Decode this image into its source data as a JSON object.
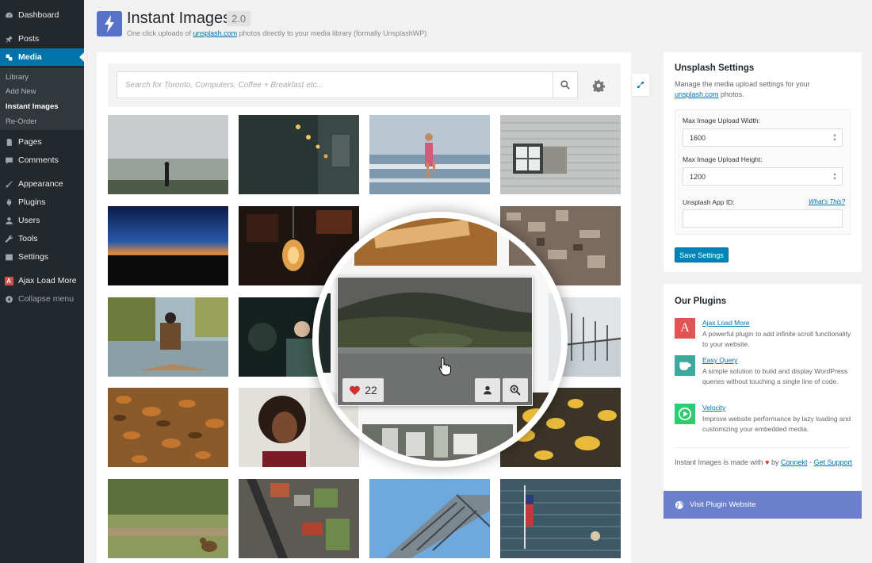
{
  "sidebar": {
    "items": [
      {
        "label": "Dashboard",
        "icon": "dashboard-icon"
      },
      {
        "label": "Posts",
        "icon": "pin-icon"
      },
      {
        "label": "Media",
        "icon": "media-icon"
      },
      {
        "label": "Pages",
        "icon": "pages-icon"
      },
      {
        "label": "Comments",
        "icon": "comments-icon"
      },
      {
        "label": "Appearance",
        "icon": "brush-icon"
      },
      {
        "label": "Plugins",
        "icon": "plug-icon"
      },
      {
        "label": "Users",
        "icon": "user-icon"
      },
      {
        "label": "Tools",
        "icon": "wrench-icon"
      },
      {
        "label": "Settings",
        "icon": "settings-icon"
      },
      {
        "label": "Ajax Load More",
        "icon": "ajax-load-more-icon"
      },
      {
        "label": "Collapse menu",
        "icon": "collapse-icon"
      }
    ],
    "submenu": [
      "Library",
      "Add New",
      "Instant Images",
      "Re-Order"
    ],
    "alm_icon_letter": "A"
  },
  "header": {
    "title": "Instant Images",
    "version": "2.0",
    "desc_before": "One click uploads of",
    "desc_link": "unsplash.com",
    "desc_after": "photos directly to your media library (formally UnsplashWP)"
  },
  "search": {
    "placeholder": "Search for Toronto, Computers, Coffee + Breakfast etc..."
  },
  "magnifier": {
    "likes": "22"
  },
  "settings_box": {
    "title": "Unsplash Settings",
    "desc_before": "Manage the media upload settings for your",
    "desc_link": "unsplash.com",
    "desc_after": "photos.",
    "width_label": "Max Image Upload Width:",
    "width_value": "1600",
    "height_label": "Max Image Upload Height:",
    "height_value": "1200",
    "appid_label": "Unsplash App ID:",
    "appid_value": "",
    "whats_this": "What's This?",
    "save_label": "Save Settings"
  },
  "plugins_box": {
    "title": "Our Plugins",
    "plugins": [
      {
        "name": "Ajax Load More",
        "desc": "A powerful plugin to add infinite scroll functionality to your website.",
        "color": "#e35353",
        "icon": "A"
      },
      {
        "name": "Easy Query",
        "desc": "A simple solution to build and display WordPress queries without touching a single line of code.",
        "color": "#3ba99c",
        "icon": "cup"
      },
      {
        "name": "Velocity",
        "desc": "Improve website performance by lazy loading and customizing your embedded media.",
        "color": "#2ecc71",
        "icon": "play"
      }
    ],
    "footer_before": "Instant Images is made with",
    "footer_by": "by",
    "footer_link1": "Connekt",
    "footer_sep": "-",
    "footer_link2": "Get Support"
  },
  "visit_label": "Visit Plugin Website",
  "colors": {
    "accent": "#0073aa",
    "brand": "#5872c8",
    "visit": "#6b7fcc"
  }
}
